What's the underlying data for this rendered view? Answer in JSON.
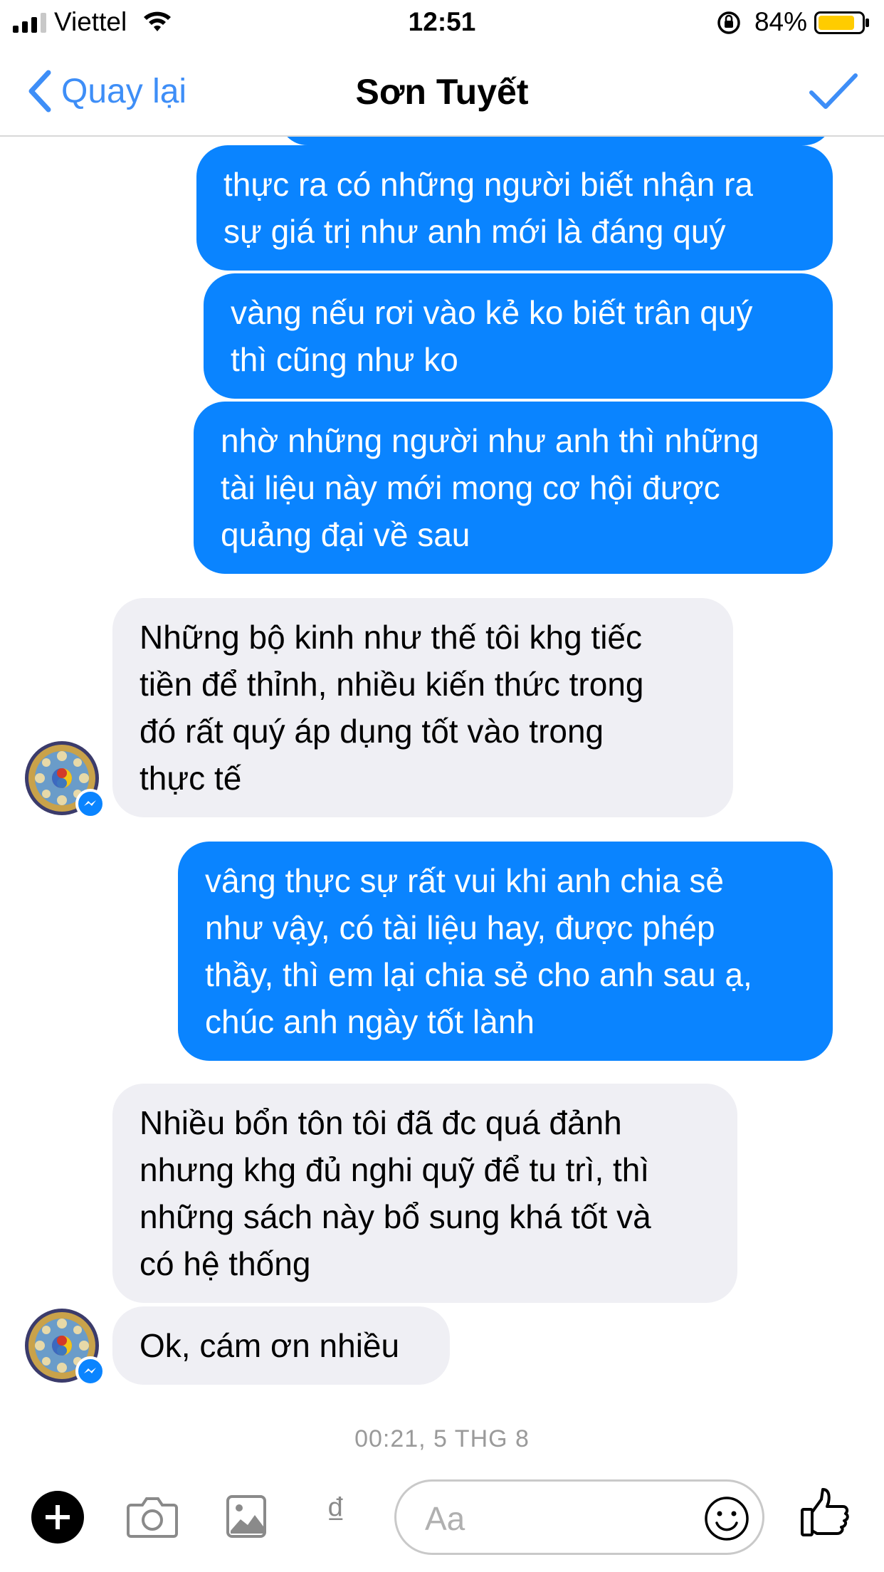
{
  "status_bar": {
    "carrier": "Viettel",
    "time": "12:51",
    "battery_percent": "84%",
    "battery_level": 0.84,
    "battery_color": "#ffcc00"
  },
  "nav": {
    "back_label": "Quay lại",
    "title": "Sơn Tuyết",
    "accent_color": "#3e8ef7"
  },
  "messages": [
    {
      "sender": "me",
      "lines": [
        "thực ra có những người biết nhận ra",
        "sự giá trị như anh mới là đáng quý"
      ]
    },
    {
      "sender": "me",
      "lines": [
        "vàng nếu rơi vào kẻ ko biết trân quý",
        "thì cũng như ko"
      ]
    },
    {
      "sender": "me",
      "lines": [
        "nhờ những người như anh thì những",
        "tài liệu này mới mong cơ hội được",
        "quảng đại về sau"
      ]
    },
    {
      "sender": "them",
      "lines": [
        "Những bộ kinh như thế tôi khg tiếc",
        "tiền để thỉnh, nhiều kiến thức trong",
        "đó rất quý áp dụng tốt vào trong",
        "thực tế"
      ]
    },
    {
      "sender": "me",
      "lines": [
        "vâng thực sự rất vui khi anh chia sẻ",
        "như vậy, có tài liệu hay, được phép",
        "thầy, thì em lại chia sẻ cho anh sau ạ,",
        "chúc anh ngày tốt lành"
      ]
    },
    {
      "sender": "them",
      "lines": [
        "Nhiều bổn tôn tôi đã đc quá đảnh",
        "nhưng khg đủ nghi quỹ để tu trì, thì",
        "những sách này bổ sung khá tốt và",
        "có hệ thống"
      ]
    },
    {
      "sender": "them",
      "lines": [
        "Ok, cám ơn nhiều"
      ]
    }
  ],
  "timestamp": "00:21, 5 THG 8",
  "composer": {
    "placeholder": "Aa",
    "currency_symbol": "₫",
    "icons": [
      "plus-icon",
      "camera-icon",
      "image-icon",
      "dong-icon",
      "emoji-icon",
      "thumbs-up-icon"
    ]
  },
  "colors": {
    "outgoing_bubble": "#0a84ff",
    "incoming_bubble": "#efeff4",
    "timestamp_text": "#9a9a9a"
  }
}
